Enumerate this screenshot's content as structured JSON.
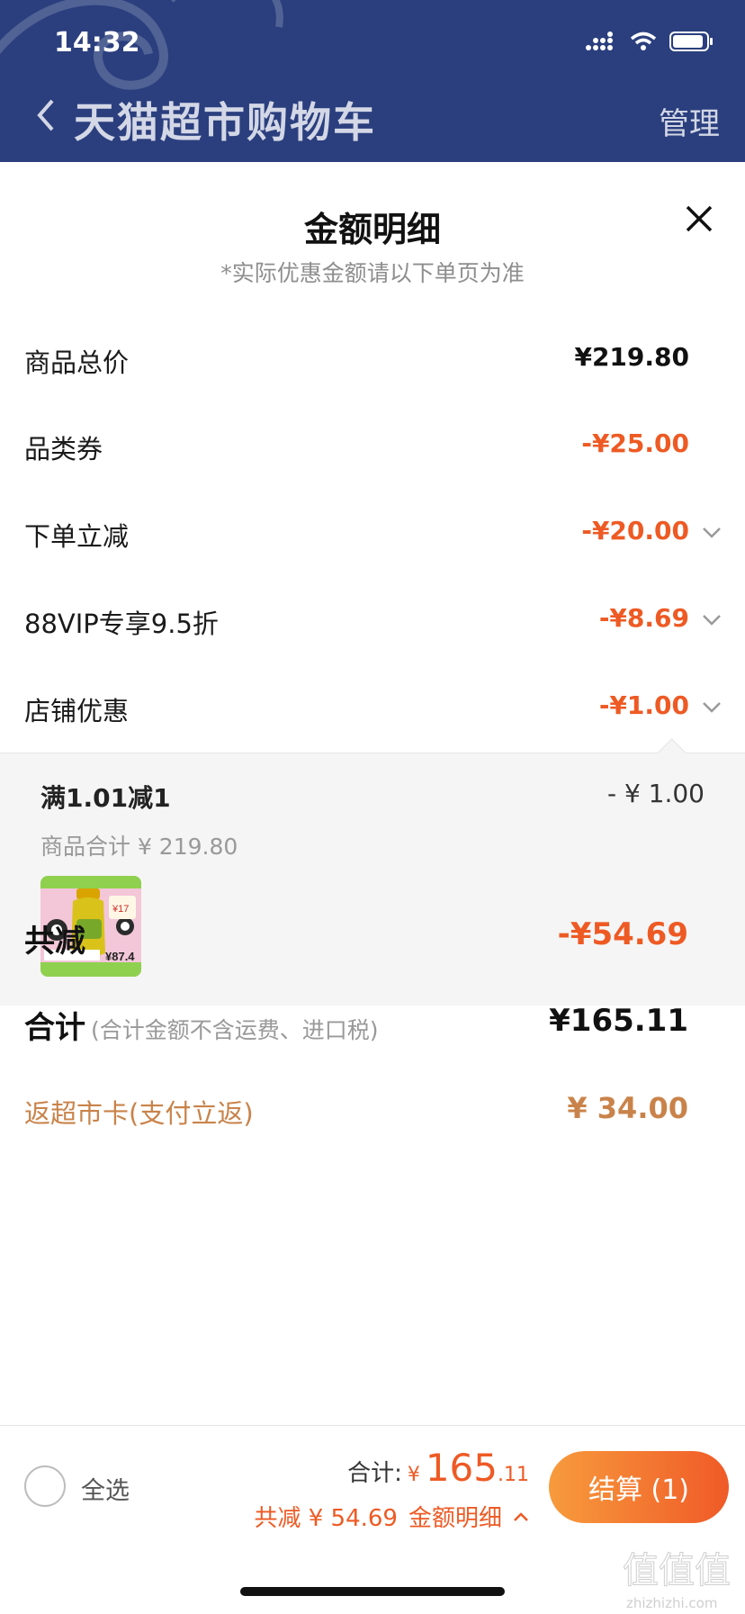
{
  "status_bar": {
    "time": "14:32"
  },
  "nav": {
    "title": "天猫超市购物车",
    "manage": "管理"
  },
  "sheet": {
    "title": "金额明细",
    "subtitle": "*实际优惠金额请以下单页为准",
    "rows": [
      {
        "label": "商品总价",
        "value": "¥219.80"
      },
      {
        "label": "品类券",
        "value": "-¥25.00"
      },
      {
        "label": "下单立减",
        "value": "-¥20.00"
      },
      {
        "label": "88VIP专享9.5折",
        "value": "-¥8.69"
      },
      {
        "label": "店铺优惠",
        "value": "-¥1.00"
      }
    ],
    "shop_detail": {
      "title": "满1.01减1",
      "amount": "- ¥ 1.00",
      "subtotal": "商品合计 ¥ 219.80",
      "thumb_text": "¥87.4",
      "thumb_price_tag": "¥17"
    },
    "total_discount": {
      "label": "共减",
      "value": "-¥54.69"
    },
    "total": {
      "label": "合计",
      "note": "(合计金额不含运费、进口税)",
      "value": "¥165.11"
    },
    "cashback": {
      "label": "返超市卡(支付立返)",
      "value": "¥ 34.00"
    }
  },
  "bottom_bar": {
    "select_all": "全选",
    "sum_label": "合计:",
    "sum_yen": "¥",
    "sum_int": "165",
    "sum_dec": ".11",
    "discount_text": "共减 ¥ 54.69",
    "detail_link": "金额明细",
    "checkout": "结算 (1)"
  },
  "watermark": {
    "text": "值值值",
    "sub": "zhizhizhi.com"
  },
  "colors": {
    "nav_bg": "#2b3f7e",
    "accent": "#ee5a24",
    "cashback": "#c9834a"
  }
}
